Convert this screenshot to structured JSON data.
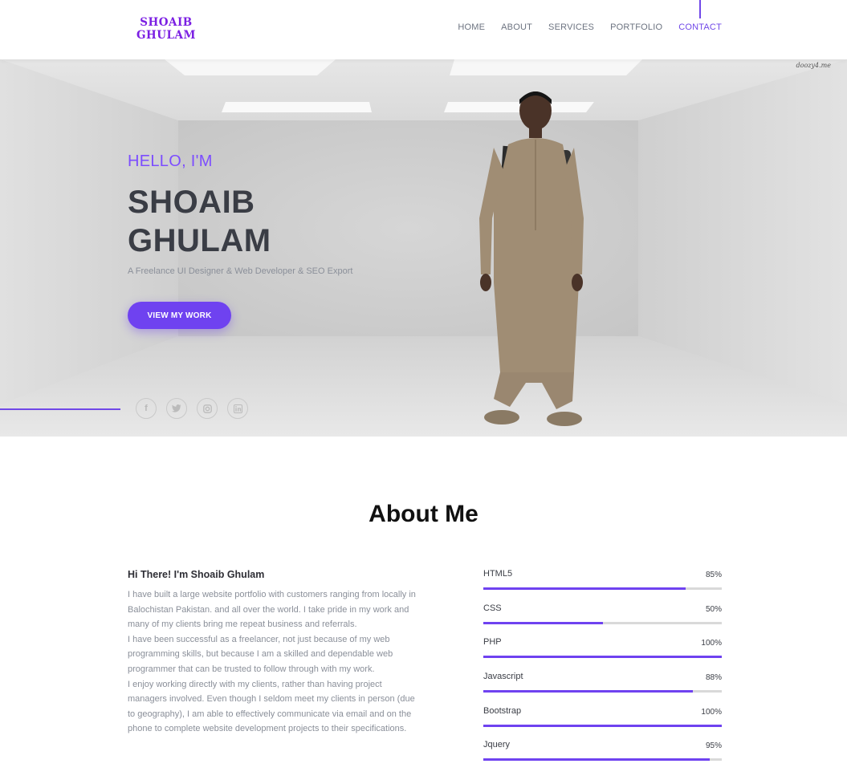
{
  "header": {
    "logo_line1": "SHOAIB",
    "logo_line2": "GHULAM",
    "nav": [
      "HOME",
      "ABOUT",
      "SERVICES",
      "PORTFOLIO",
      "CONTACT"
    ],
    "active_nav": "CONTACT",
    "accent_color": "#7048e8"
  },
  "hero": {
    "watermark": "doozy4.me",
    "greeting": "HELLO, I'M",
    "name_line1": "SHOAIB",
    "name_line2": "GHULAM",
    "tagline": "A Freelance UI Designer & Web Developer & SEO Export",
    "cta_label": "VIEW MY WORK",
    "socials": [
      "facebook-icon",
      "twitter-icon",
      "instagram-icon",
      "linkedin-icon"
    ]
  },
  "about": {
    "title": "About Me",
    "heading": "Hi There! I'm Shoaib Ghulam",
    "paragraphs": [
      "I have built a large website portfolio with customers ranging from locally in Balochistan Pakistan. and all over the world. I take pride in my work and many of my clients bring me repeat business and referrals.",
      "I have been successful as a freelancer, not just because of my web programming skills, but because I am a skilled and dependable web programmer that can be trusted to follow through with my work.",
      "I enjoy working directly with my clients, rather than having project managers involved. Even though I seldom meet my clients in person (due to geography), I am able to effectively communicate via email and on the phone to complete website development projects to their specifications."
    ],
    "skills": [
      {
        "name": "HTML5",
        "percent_label": "85%",
        "level": 0.85
      },
      {
        "name": "CSS",
        "percent_label": "50%",
        "level": 0.5
      },
      {
        "name": "PHP",
        "percent_label": "100%",
        "level": 1.0
      },
      {
        "name": "Javascript",
        "percent_label": "88%",
        "level": 0.88
      },
      {
        "name": "Bootstrap",
        "percent_label": "100%",
        "level": 1.0
      },
      {
        "name": "Jquery",
        "percent_label": "95%",
        "level": 0.95
      }
    ]
  }
}
